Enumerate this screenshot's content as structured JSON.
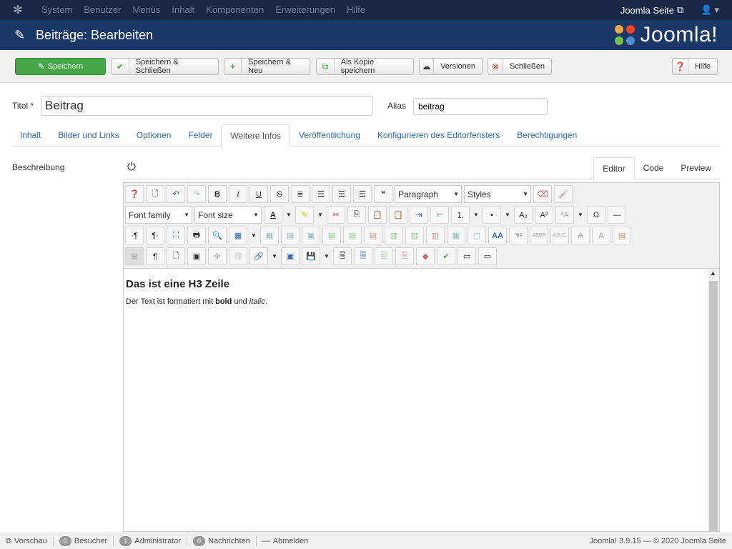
{
  "topnav": {
    "menu": [
      "System",
      "Benutzer",
      "Menüs",
      "Inhalt",
      "Komponenten",
      "Erweiterungen",
      "Hilfe"
    ],
    "site_link": "Joomla Seite",
    "user_caret": "▾"
  },
  "titlebar": {
    "title": "Beiträge: Bearbeiten",
    "brand": "Joomla!"
  },
  "toolbar": {
    "save": "Speichern",
    "save_close": "Speichern & Schließen",
    "save_new": "Speichern & Neu",
    "save_copy": "Als Kopie speichern",
    "versions": "Versionen",
    "close": "Schließen",
    "help": "Hilfe"
  },
  "form": {
    "title_label": "Titel *",
    "title_value": "Beitrag",
    "alias_label": "Alias",
    "alias_value": "beitrag",
    "desc_label": "Beschreibung"
  },
  "tabs": [
    "Inhalt",
    "Bilder und Links",
    "Optionen",
    "Felder",
    "Weitere Infos",
    "Veröffentlichung",
    "Konfigurieren des Editorfensters",
    "Berechtigungen"
  ],
  "editor_tabs": [
    "Editor",
    "Code",
    "Preview"
  ],
  "editor": {
    "format_select": "Paragraph",
    "styles_select": "Styles",
    "font_family": "Font family",
    "font_size": "Font size",
    "heading": "Das ist eine H3 Zeile",
    "para_start": "Der Text ist formatiert mit ",
    "para_bold": "bold",
    "para_mid": " und ",
    "para_italic": "italic",
    "para_end": "."
  },
  "status": {
    "preview": "Vorschau",
    "visitors_count": "0",
    "visitors": "Besucher",
    "admin_count": "1",
    "admin": "Administrator",
    "messages_count": "0",
    "messages": "Nachrichten",
    "logout": "Abmelden",
    "copyright": "Joomla! 3.9.15 — © 2020 Joomla Seite"
  }
}
